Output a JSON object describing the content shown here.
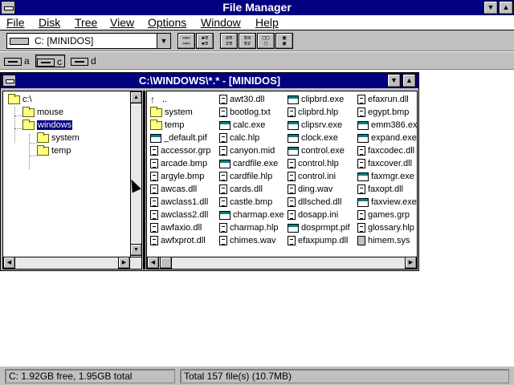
{
  "app": {
    "title": "File Manager"
  },
  "menu": [
    {
      "label": "File"
    },
    {
      "label": "Disk"
    },
    {
      "label": "Tree"
    },
    {
      "label": "View"
    },
    {
      "label": "Options"
    },
    {
      "label": "Window"
    },
    {
      "label": "Help"
    }
  ],
  "toolbar": {
    "drive_value": "C: [MINIDOS]",
    "dropdown_arrow": "▼"
  },
  "drives": [
    {
      "letter": "a"
    },
    {
      "letter": "c"
    },
    {
      "letter": "d"
    }
  ],
  "child": {
    "title": "C:\\WINDOWS\\*.* - [MINIDOS]",
    "down_arrow": "▼",
    "up_arrow": "▲"
  },
  "tree": {
    "root": "c:\\",
    "items": [
      {
        "label": "mouse"
      },
      {
        "label": "windows"
      },
      {
        "label": "system"
      },
      {
        "label": "temp"
      }
    ]
  },
  "files": {
    "columns": [
      [
        {
          "name": "..",
          "icon": "up-arrow-icon"
        },
        {
          "name": "system",
          "icon": "folder-icon"
        },
        {
          "name": "temp",
          "icon": "folder-icon"
        },
        {
          "name": "_default.pif",
          "icon": "program-icon"
        },
        {
          "name": "accessor.grp",
          "icon": "document-icon"
        },
        {
          "name": "arcade.bmp",
          "icon": "document-icon"
        },
        {
          "name": "argyle.bmp",
          "icon": "document-icon"
        },
        {
          "name": "awcas.dll",
          "icon": "document-icon"
        },
        {
          "name": "awclass1.dll",
          "icon": "document-icon"
        },
        {
          "name": "awclass2.dll",
          "icon": "document-icon"
        },
        {
          "name": "awfaxio.dll",
          "icon": "document-icon"
        },
        {
          "name": "awfxprot.dll",
          "icon": "document-icon"
        }
      ],
      [
        {
          "name": "awt30.dll",
          "icon": "document-icon"
        },
        {
          "name": "bootlog.txt",
          "icon": "document-icon"
        },
        {
          "name": "calc.exe",
          "icon": "program-icon"
        },
        {
          "name": "calc.hlp",
          "icon": "document-icon"
        },
        {
          "name": "canyon.mid",
          "icon": "document-icon"
        },
        {
          "name": "cardfile.exe",
          "icon": "program-icon"
        },
        {
          "name": "cardfile.hlp",
          "icon": "document-icon"
        },
        {
          "name": "cards.dll",
          "icon": "document-icon"
        },
        {
          "name": "castle.bmp",
          "icon": "document-icon"
        },
        {
          "name": "charmap.exe",
          "icon": "program-icon"
        },
        {
          "name": "charmap.hlp",
          "icon": "document-icon"
        },
        {
          "name": "chimes.wav",
          "icon": "document-icon"
        }
      ],
      [
        {
          "name": "clipbrd.exe",
          "icon": "program-icon"
        },
        {
          "name": "clipbrd.hlp",
          "icon": "document-icon"
        },
        {
          "name": "clipsrv.exe",
          "icon": "program-icon"
        },
        {
          "name": "clock.exe",
          "icon": "program-icon"
        },
        {
          "name": "control.exe",
          "icon": "program-icon"
        },
        {
          "name": "control.hlp",
          "icon": "document-icon"
        },
        {
          "name": "control.ini",
          "icon": "document-icon"
        },
        {
          "name": "ding.wav",
          "icon": "document-icon"
        },
        {
          "name": "dllsched.dll",
          "icon": "document-icon"
        },
        {
          "name": "dosapp.ini",
          "icon": "document-icon"
        },
        {
          "name": "dosprmpt.pif",
          "icon": "program-icon"
        },
        {
          "name": "efaxpump.dll",
          "icon": "document-icon"
        }
      ],
      [
        {
          "name": "efaxrun.dll",
          "icon": "document-icon"
        },
        {
          "name": "egypt.bmp",
          "icon": "document-icon"
        },
        {
          "name": "emm386.exe",
          "icon": "program-icon"
        },
        {
          "name": "expand.exe",
          "icon": "program-icon"
        },
        {
          "name": "faxcodec.dll",
          "icon": "document-icon"
        },
        {
          "name": "faxcover.dll",
          "icon": "document-icon"
        },
        {
          "name": "faxmgr.exe",
          "icon": "program-icon"
        },
        {
          "name": "faxopt.dll",
          "icon": "document-icon"
        },
        {
          "name": "faxview.exe",
          "icon": "program-icon"
        },
        {
          "name": "games.grp",
          "icon": "document-icon"
        },
        {
          "name": "glossary.hlp",
          "icon": "document-icon"
        },
        {
          "name": "himem.sys",
          "icon": "system-file-icon"
        }
      ]
    ]
  },
  "status": {
    "left": "C: 1.92GB free,  1.95GB total",
    "right": "Total 157 file(s) (10.7MB)"
  },
  "colors": {
    "title_bar": "#000080",
    "face": "#c0c0c0",
    "folder": "#ffff80"
  }
}
